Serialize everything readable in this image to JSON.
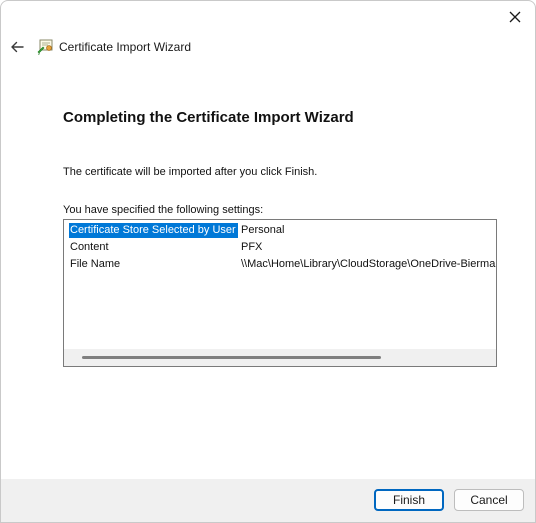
{
  "window": {
    "close_icon": "close-icon"
  },
  "header": {
    "back_icon": "back-arrow-icon",
    "wizard_icon": "certificate-icon",
    "title": "Certificate Import Wizard"
  },
  "main": {
    "heading": "Completing the Certificate Import Wizard",
    "description": "The certificate will be imported after you click Finish.",
    "settings_label": "You have specified the following settings:",
    "settings": [
      {
        "key": "Certificate Store Selected by User",
        "value": "Personal"
      },
      {
        "key": "Content",
        "value": "PFX"
      },
      {
        "key": "File Name",
        "value": "\\\\Mac\\Home\\Library\\CloudStorage\\OneDrive-Bierman"
      }
    ],
    "selection_color": "#0078d7"
  },
  "footer": {
    "finish_label": "Finish",
    "cancel_label": "Cancel",
    "accent_color": "#0067c0"
  }
}
